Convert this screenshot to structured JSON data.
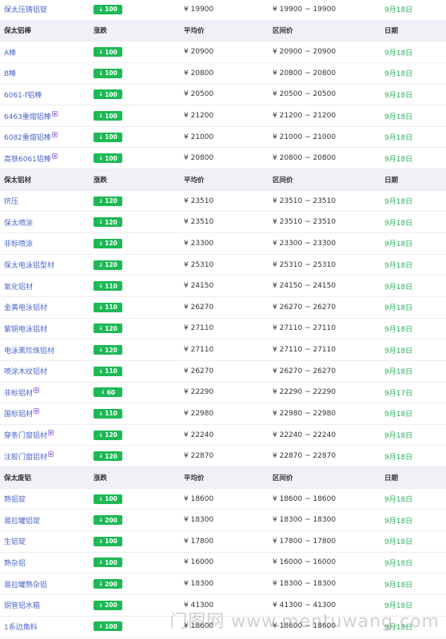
{
  "headers": {
    "change": "涨跌",
    "avg": "平均价",
    "range": "区间价",
    "date": "日期"
  },
  "sections": [
    {
      "title": "",
      "rows": [
        {
          "name": "保太压铸铝锭",
          "change": "100",
          "avg": "¥ 19900",
          "range": "¥ 19900 ~ 19900",
          "date": "9月18日",
          "ext": false
        }
      ]
    },
    {
      "title": "保太铝棒",
      "rows": [
        {
          "name": "A棒",
          "change": "100",
          "avg": "¥ 20900",
          "range": "¥ 20900 ~ 20900",
          "date": "9月18日",
          "ext": false
        },
        {
          "name": "B棒",
          "change": "100",
          "avg": "¥ 20800",
          "range": "¥ 20800 ~ 20800",
          "date": "9月18日",
          "ext": false
        },
        {
          "name": "6061-f铝棒",
          "change": "100",
          "avg": "¥ 20500",
          "range": "¥ 20500 ~ 20500",
          "date": "9月18日",
          "ext": false
        },
        {
          "name": "6463重熔铝棒",
          "change": "100",
          "avg": "¥ 21200",
          "range": "¥ 21200 ~ 21200",
          "date": "9月18日",
          "ext": true
        },
        {
          "name": "6082重熔铝棒",
          "change": "100",
          "avg": "¥ 21000",
          "range": "¥ 21000 ~ 21000",
          "date": "9月18日",
          "ext": true
        },
        {
          "name": "高铁6061铝棒",
          "change": "100",
          "avg": "¥ 20800",
          "range": "¥ 20800 ~ 20800",
          "date": "9月18日",
          "ext": true
        }
      ]
    },
    {
      "title": "保太铝材",
      "rows": [
        {
          "name": "挤压",
          "change": "120",
          "avg": "¥ 23510",
          "range": "¥ 23510 ~ 23510",
          "date": "9月18日",
          "ext": false
        },
        {
          "name": "保太喷涂",
          "change": "120",
          "avg": "¥ 23510",
          "range": "¥ 23510 ~ 23510",
          "date": "9月18日",
          "ext": false
        },
        {
          "name": "非标喷涂",
          "change": "120",
          "avg": "¥ 23300",
          "range": "¥ 23300 ~ 23300",
          "date": "9月18日",
          "ext": false
        },
        {
          "name": "保太电泳铝型材",
          "change": "120",
          "avg": "¥ 25310",
          "range": "¥ 25310 ~ 25310",
          "date": "9月18日",
          "ext": false
        },
        {
          "name": "氧化铝材",
          "change": "110",
          "avg": "¥ 24150",
          "range": "¥ 24150 ~ 24150",
          "date": "9月18日",
          "ext": false
        },
        {
          "name": "金黄电泳铝材",
          "change": "110",
          "avg": "¥ 26270",
          "range": "¥ 26270 ~ 26270",
          "date": "9月18日",
          "ext": false
        },
        {
          "name": "紫铜电泳铝材",
          "change": "120",
          "avg": "¥ 27110",
          "range": "¥ 27110 ~ 27110",
          "date": "9月18日",
          "ext": false
        },
        {
          "name": "电泳黑珍珠铝材",
          "change": "120",
          "avg": "¥ 27110",
          "range": "¥ 27110 ~ 27110",
          "date": "9月18日",
          "ext": false
        },
        {
          "name": "喷涂木纹铝材",
          "change": "110",
          "avg": "¥ 26270",
          "range": "¥ 26270 ~ 26270",
          "date": "9月18日",
          "ext": false
        },
        {
          "name": "非标铝材",
          "change": "60",
          "avg": "¥ 22290",
          "range": "¥ 22290 ~ 22290",
          "date": "9月17日",
          "ext": true
        },
        {
          "name": "国标铝材",
          "change": "110",
          "avg": "¥ 22980",
          "range": "¥ 22980 ~ 22980",
          "date": "9月18日",
          "ext": true
        },
        {
          "name": "穿条门窗铝材",
          "change": "120",
          "avg": "¥ 22240",
          "range": "¥ 22240 ~ 22240",
          "date": "9月18日",
          "ext": true
        },
        {
          "name": "注胶门窗铝材",
          "change": "120",
          "avg": "¥ 22870",
          "range": "¥ 22870 ~ 22870",
          "date": "9月18日",
          "ext": true
        }
      ]
    },
    {
      "title": "保太废铝",
      "rows": [
        {
          "name": "熟铝锭",
          "change": "100",
          "avg": "¥ 18600",
          "range": "¥ 18600 ~ 18600",
          "date": "9月18日",
          "ext": false
        },
        {
          "name": "易拉罐铝锭",
          "change": "200",
          "avg": "¥ 18300",
          "range": "¥ 18300 ~ 18300",
          "date": "9月18日",
          "ext": false
        },
        {
          "name": "生铝锭",
          "change": "100",
          "avg": "¥ 17800",
          "range": "¥ 17800 ~ 17800",
          "date": "9月18日",
          "ext": false
        },
        {
          "name": "熟杂铝",
          "change": "100",
          "avg": "¥ 16000",
          "range": "¥ 16000 ~ 16000",
          "date": "9月18日",
          "ext": false
        },
        {
          "name": "易拉罐熟杂铝",
          "change": "200",
          "avg": "¥ 18300",
          "range": "¥ 18300 ~ 18300",
          "date": "9月18日",
          "ext": false
        },
        {
          "name": "铜管铝水箱",
          "change": "200",
          "avg": "¥ 41300",
          "range": "¥ 41300 ~ 41300",
          "date": "9月18日",
          "ext": false
        },
        {
          "name": "1系边角料",
          "change": "100",
          "avg": "¥ 18600",
          "range": "¥ 18600 ~ 18600",
          "date": "9月18日",
          "ext": false
        }
      ]
    }
  ],
  "watermark": "门图网 www.mentuwang.com",
  "colors": {
    "badge": "#1db954",
    "link": "#4a66c9",
    "date": "#2ab159",
    "header_bg": "#f0f0f6"
  }
}
